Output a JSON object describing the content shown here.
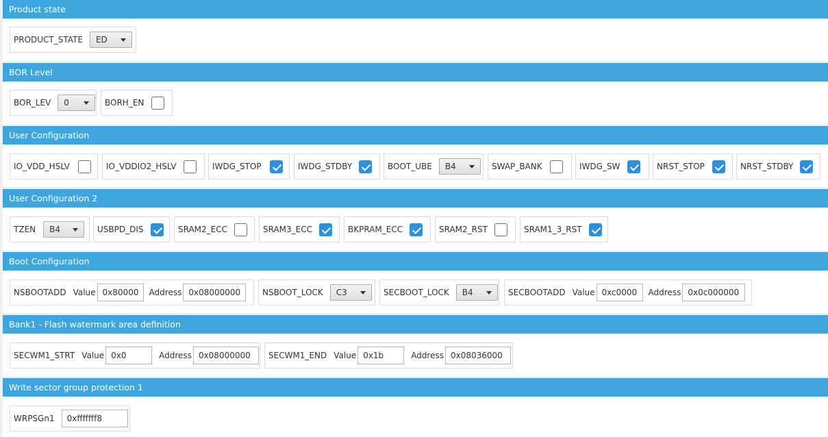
{
  "sections": {
    "product_state": {
      "title": "Product state",
      "product_state": {
        "label": "PRODUCT_STATE",
        "value": "ED"
      }
    },
    "bor_level": {
      "title": "BOR Level",
      "bor_lev": {
        "label": "BOR_LEV",
        "value": "0"
      },
      "borh_en": {
        "label": "BORH_EN",
        "checked": false
      }
    },
    "user_config": {
      "title": "User Configuration",
      "io_vdd_hslv": {
        "label": "IO_VDD_HSLV",
        "checked": false
      },
      "io_vddio2_hslv": {
        "label": "IO_VDDIO2_HSLV",
        "checked": false
      },
      "iwdg_stop": {
        "label": "IWDG_STOP",
        "checked": true
      },
      "iwdg_stdby": {
        "label": "IWDG_STDBY",
        "checked": true
      },
      "boot_ube": {
        "label": "BOOT_UBE",
        "value": "B4"
      },
      "swap_bank": {
        "label": "SWAP_BANK",
        "checked": false
      },
      "iwdg_sw": {
        "label": "IWDG_SW",
        "checked": true
      },
      "nrst_stop": {
        "label": "NRST_STOP",
        "checked": true
      },
      "nrst_stdby": {
        "label": "NRST_STDBY",
        "checked": true
      }
    },
    "user_config2": {
      "title": "User Configuration 2",
      "tzen": {
        "label": "TZEN",
        "value": "B4"
      },
      "usbpd_dis": {
        "label": "USBPD_DIS",
        "checked": true
      },
      "sram2_ecc": {
        "label": "SRAM2_ECC",
        "checked": false
      },
      "sram3_ecc": {
        "label": "SRAM3_ECC",
        "checked": true
      },
      "bkpram_ecc": {
        "label": "BKPRAM_ECC",
        "checked": true
      },
      "sram2_rst": {
        "label": "SRAM2_RST",
        "checked": false
      },
      "sram1_3_rst": {
        "label": "SRAM1_3_RST",
        "checked": true
      }
    },
    "boot_config": {
      "title": "Boot Configuration",
      "nsbootadd": {
        "label": "NSBOOTADD",
        "value_label": "Value",
        "value": "0x80000",
        "address_label": "Address",
        "address": "0x08000000"
      },
      "nsboot_lock": {
        "label": "NSBOOT_LOCK",
        "value": "C3"
      },
      "secboot_lock": {
        "label": "SECBOOT_LOCK",
        "value": "B4"
      },
      "secbootadd": {
        "label": "SECBOOTADD",
        "value_label": "Value",
        "value": "0xc0000",
        "address_label": "Address",
        "address": "0x0c000000"
      }
    },
    "bank1_watermark": {
      "title": "Bank1 - Flash watermark area definition",
      "secwm1_strt": {
        "label": "SECWM1_STRT",
        "value_label": "Value",
        "value": "0x0",
        "address_label": "Address",
        "address": "0x08000000"
      },
      "secwm1_end": {
        "label": "SECWM1_END",
        "value_label": "Value",
        "value": "0x1b",
        "address_label": "Address",
        "address": "0x08036000"
      }
    },
    "write_protect": {
      "title": "Write sector group protection 1",
      "wrpsgn1": {
        "label": "WRPSGn1",
        "value": "0xfffffff8"
      }
    }
  },
  "colors": {
    "header_bg": "#3ea6dc",
    "checkbox_on": "#2f8fdc"
  },
  "icons": {
    "dropdown": "chevron-down-icon",
    "checkbox": "checkmark-icon"
  }
}
